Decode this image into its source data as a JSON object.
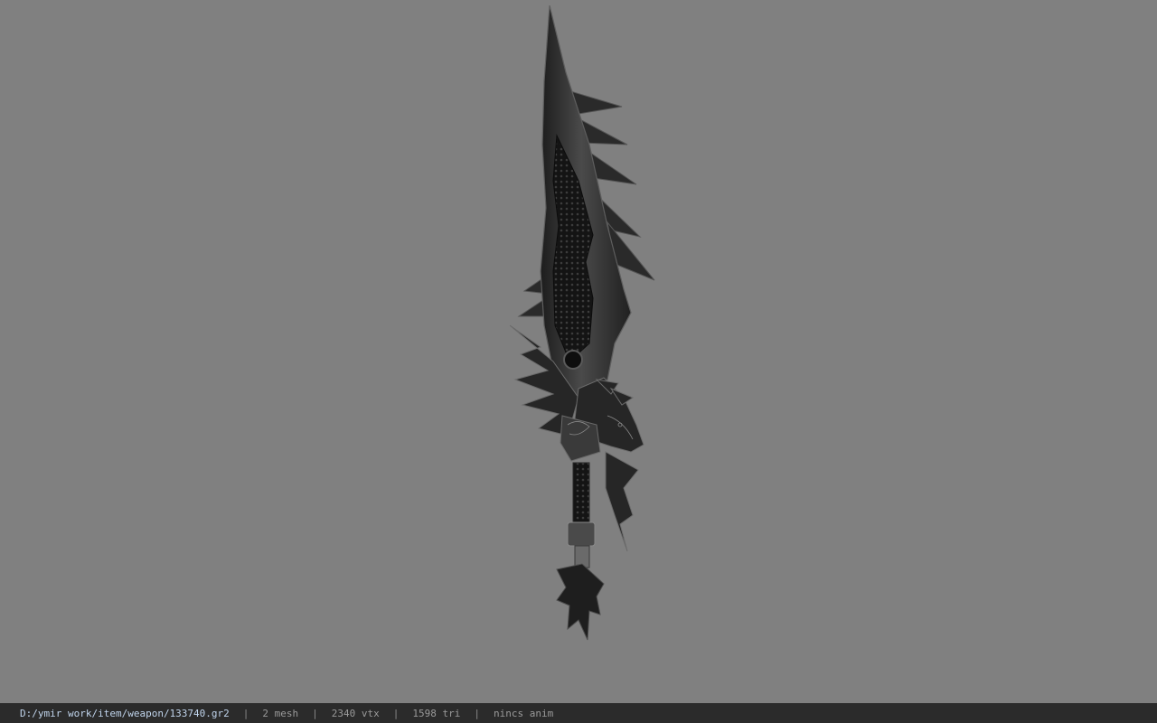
{
  "viewer": {
    "background_color": "#808080",
    "model_icon": "sword-model"
  },
  "status": {
    "path": "D:/ymir work/item/weapon/133740.gr2",
    "mesh": "2 mesh",
    "vertices": "2340 vtx",
    "triangles": "1598 tri",
    "animation": "nincs anim",
    "separator": "|"
  }
}
